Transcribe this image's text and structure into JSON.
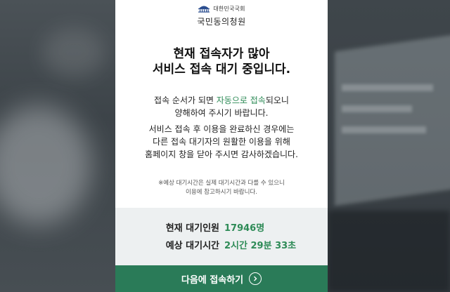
{
  "header": {
    "logo_text": "대한민국국회",
    "site_name": "국민동의청원"
  },
  "message": {
    "headline_line1": "현재 접속자가 많아",
    "headline_line2": "서비스 접속 대기 중입니다.",
    "p1_before": "접속 순서가 되면 ",
    "p1_highlight": "자동으로 접속",
    "p1_after": "되오니",
    "p1_line2": "양해하여 주시기 바랍니다.",
    "p2_line1": "서비스 접속 후 이용을 완료하신 경우에는",
    "p2_line2": "다른 접속 대기자의 원활한 이용을 위해",
    "p2_line3": "홈페이지 창을 닫아 주시면 감사하겠습니다.",
    "note_line1": "※예상 대기시간은 실제 대기시간과 다를 수 있으니",
    "note_line2": "이용에 참고하시기 바랍니다."
  },
  "status": {
    "waiting_label": "현재 대기인원",
    "waiting_value": "17946명",
    "time_label": "예상 대기시간",
    "time_value": "2시간 29분 33초"
  },
  "cta": {
    "label": "다음에 접속하기",
    "icon": "chevron-right-circle-icon"
  },
  "colors": {
    "accent": "#2e8b57",
    "button": "#2a7b58",
    "status_bg": "#edf0f1"
  }
}
